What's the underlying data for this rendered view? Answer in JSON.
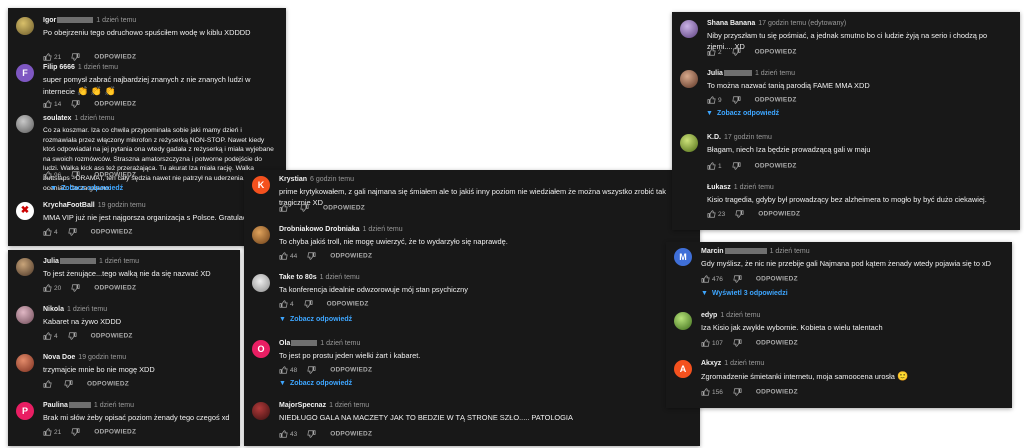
{
  "labels": {
    "reply": "ODPOWIEDZ"
  },
  "colors": {
    "panel_bg": "#181818",
    "link": "#3ea6ff",
    "muted": "#aaaaaa"
  },
  "panels": {
    "p1": {
      "comments": [
        {
          "author": "Igor",
          "time": "1 dzień temu",
          "text": "Po obejrzeniu tego odruchowo spuściłem wodę w kiblu XDDDD",
          "likes": "21"
        },
        {
          "author": "Filip 6666",
          "time": "1 dzień temu",
          "text": "super pomysł zabrać najbardziej znanych z nie znanych ludzi w internecie",
          "emoji": "👏 👏 👏",
          "likes": "14",
          "initial": "F"
        },
        {
          "author": "soulatex",
          "time": "1 dzień temu",
          "text": "Co za koszmar. Iza co chwila przypominała sobie jaki mamy dzień i rozmawiała przez włączony mikrofon z reżyserką NON-STOP. Nawet kiedy ktoś odpowiadał na jej pytania ona wtedy gadała z reżyserką i miała wyjebane na swoich rozmówców. Straszna amatorszczyzna i potworne podejście do ludzi. Walka kick ass też przerażająca. Tu akurat Iza miała rację. Walka buttslaps - DRAMAT, ten cały sędzia nawet nie patrzył na uderzenia, które miał oceniać. Co za gówno.",
          "likes": "96",
          "view": "Zobacz odpowiedź"
        },
        {
          "author": "KrychaFootBall",
          "time": "19 godzin temu",
          "text": "MMA VIP już nie jest najgorsza organizacja s Polsce. Gratulacje",
          "likes": "4"
        }
      ]
    },
    "p2": {
      "comments": [
        {
          "author": "Julia",
          "time": "1 dzień temu",
          "text": "To jest żenujące...tego walką nie da się nazwać XD",
          "likes": "20"
        },
        {
          "author": "Nikola",
          "time": "1 dzień temu",
          "text": "Kabaret na żywo XDDD",
          "likes": "4"
        },
        {
          "author": "Nova Doe",
          "time": "19 godzin temu",
          "text": "trzymajcie mnie bo nie mogę XDD",
          "likes": ""
        },
        {
          "author": "Paulina",
          "time": "1 dzień temu",
          "text": "Brak mi słów żeby opisać poziom żenady tego czegoś xd",
          "likes": "21",
          "initial": "P"
        }
      ]
    },
    "p3": {
      "comments": [
        {
          "author": "Krystian",
          "time": "6 godzin temu",
          "text": "prime krytykowałem, z gali najmana się śmiałem ale to jakiś inny poziom nie wiedziałem że można wszystko zrobić tak tragicznie XD",
          "likes": "",
          "initial": "K"
        },
        {
          "author": "Drobniakowo Drobniaka",
          "time": "1 dzień temu",
          "text": "To chyba jakiś troll, nie mogę uwierzyć, że to wydarzyło się naprawdę.",
          "likes": "44"
        },
        {
          "author": "Take to 80s",
          "time": "1 dzień temu",
          "text": "Ta konferencja idealnie odwzorowuje mój stan psychiczny",
          "likes": "4",
          "view": "Zobacz odpowiedź"
        },
        {
          "author": "Ola",
          "time": "1 dzień temu",
          "text": "To jest po prostu jeden wielki żart i kabaret.",
          "likes": "48",
          "view": "Zobacz odpowiedź",
          "initial": "O"
        },
        {
          "author": "MajorSpecnaz",
          "time": "1 dzień temu",
          "text": "NIEDŁUGO GALA NA MACZETY JAK TO BEDZIE W TĄ STRONE SZŁO..... PATOLOGIA",
          "likes": "43"
        }
      ]
    },
    "p4": {
      "comments": [
        {
          "author": "Shana Banana",
          "time": "17 godzin temu (edytowany)",
          "text": "Niby przyszłam tu się pośmiać, a jednak smutno bo ci ludzie żyją na serio  i chodzą po ziemi.... XD",
          "likes": "2"
        },
        {
          "author": "Julia",
          "time": "1 dzień temu",
          "text": "To można nazwać tanią parodią FAME MMA XDD",
          "likes": "9",
          "view": "Zobacz odpowiedź"
        },
        {
          "author": "K.D.",
          "time": "17 godzin temu",
          "text": "Błagam, niech  Iza będzie prowadzącą gali w maju",
          "likes": "1"
        },
        {
          "author": "Łukasz",
          "time": "1 dzień temu",
          "text": "Kisio tragedia, gdyby był prowadzący bez alzheimera to mogło by być dużo ciekawiej.",
          "likes": "23"
        }
      ]
    },
    "p5": {
      "comments": [
        {
          "author": "Marcin",
          "time": "1 dzień temu",
          "text": "Gdy myślisz, że nic nie przebije gali Najmana pod kątem żenady wtedy pojawia się to xD",
          "likes": "476",
          "view": "Wyświetl 3 odpowiedzi",
          "initial": "M"
        },
        {
          "author": "edyp",
          "time": "1 dzień temu",
          "text": "Iza Kisio jak zwykle wybornie. Kobieta o wielu talentach",
          "likes": "107"
        },
        {
          "author": "Akxyz",
          "time": "1 dzień temu",
          "text": "Zgromadzenie śmietanki internetu, moja samoocena urosła",
          "emoji": "🙂",
          "likes": "156",
          "initial": "A"
        }
      ]
    }
  }
}
